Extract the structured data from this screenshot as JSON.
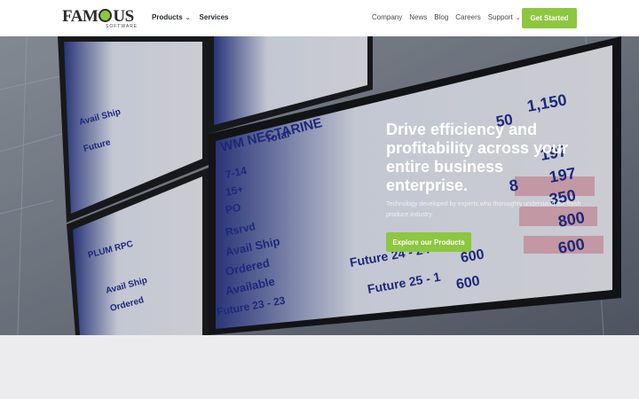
{
  "brand": {
    "name_left": "FAM",
    "name_right": "US",
    "sub": "SOFTWARE",
    "accent": "#8dc63f"
  },
  "nav": {
    "products": "Products",
    "services": "Services",
    "company": "Company",
    "news": "News",
    "blog": "Blog",
    "careers": "Careers",
    "support": "Support",
    "get_started": "Get Started"
  },
  "hero": {
    "title": "Drive efficiency and profitability across your entire business enterprise.",
    "subtitle": "Technology developed by experts who thoroughly understand the fresh produce industry.",
    "button": "Explore our Products",
    "screen_text": {
      "nectarine_header": "WM NECTARINE",
      "total": "Total",
      "rows": [
        "7-14",
        "15+",
        "PO",
        "Rsrvd",
        "Avail Ship",
        "Ordered",
        "Available",
        "Future 23 - 23",
        "Future 24 - 24",
        "Future 25 - 1"
      ],
      "right_values": [
        "1,150",
        "50",
        "197",
        "8",
        "197",
        "350",
        "800",
        "600",
        "600"
      ]
    }
  }
}
